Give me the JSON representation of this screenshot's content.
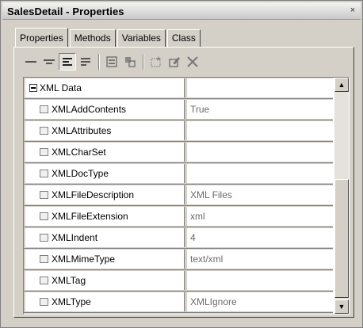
{
  "window": {
    "title": "SalesDetail - Properties",
    "close_glyph": "×"
  },
  "tabs": [
    {
      "label": "Properties",
      "active": true
    },
    {
      "label": "Methods",
      "active": false
    },
    {
      "label": "Variables",
      "active": false
    },
    {
      "label": "Class",
      "active": false
    }
  ],
  "toolbar": {
    "buttons": [
      "collapse-all-icon",
      "expand-all-icon",
      "align-left-icon",
      "align-justify-icon",
      "form-icon",
      "layout-icon",
      "new-property-icon",
      "edit-property-icon",
      "delete-icon"
    ]
  },
  "grid": {
    "group": {
      "label": "XML Data",
      "value": ""
    },
    "rows": [
      {
        "name": "XMLAddContents",
        "value": "True"
      },
      {
        "name": "XMLAttributes",
        "value": ""
      },
      {
        "name": "XMLCharSet",
        "value": ""
      },
      {
        "name": "XMLDocType",
        "value": ""
      },
      {
        "name": "XMLFileDescription",
        "value": "XML Files"
      },
      {
        "name": "XMLFileExtension",
        "value": "xml"
      },
      {
        "name": "XMLIndent",
        "value": "4"
      },
      {
        "name": "XMLMimeType",
        "value": "text/xml"
      },
      {
        "name": "XMLTag",
        "value": ""
      },
      {
        "name": "XMLType",
        "value": "XMLIgnore"
      }
    ]
  },
  "scrollbar": {
    "up_glyph": "▲",
    "down_glyph": "▼"
  }
}
